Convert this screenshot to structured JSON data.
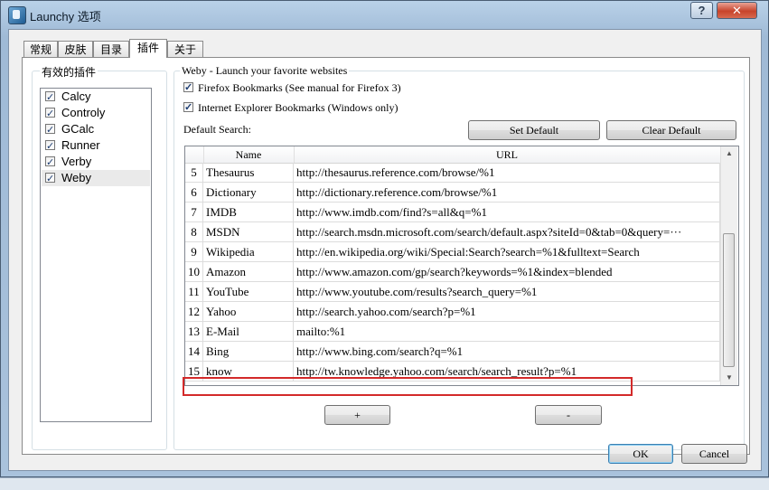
{
  "window": {
    "title": "Launchy 选项"
  },
  "tabs": [
    "常规",
    "皮肤",
    "目录",
    "插件",
    "关于"
  ],
  "plugins_group": {
    "label": "有效的插件",
    "items": [
      {
        "label": "Calcy",
        "checked": true
      },
      {
        "label": "Controly",
        "checked": true
      },
      {
        "label": "GCalc",
        "checked": true
      },
      {
        "label": "Runner",
        "checked": true
      },
      {
        "label": "Verby",
        "checked": true
      },
      {
        "label": "Weby",
        "checked": true
      }
    ]
  },
  "weby": {
    "group_label": "Weby - Launch your favorite websites",
    "firefox_label": "Firefox Bookmarks (See manual for Firefox 3)",
    "ie_label": "Internet Explorer Bookmarks (Windows only)",
    "default_search_label": "Default Search:",
    "set_default": "Set Default",
    "clear_default": "Clear Default",
    "columns": [
      "Name",
      "URL"
    ],
    "rows": [
      {
        "num": "5",
        "name": "Thesaurus",
        "url": "http://thesaurus.reference.com/browse/%1"
      },
      {
        "num": "6",
        "name": "Dictionary",
        "url": "http://dictionary.reference.com/browse/%1"
      },
      {
        "num": "7",
        "name": "IMDB",
        "url": "http://www.imdb.com/find?s=all&q=%1"
      },
      {
        "num": "8",
        "name": "MSDN",
        "url": "http://search.msdn.microsoft.com/search/default.aspx?siteId=0&tab=0&query=···"
      },
      {
        "num": "9",
        "name": "Wikipedia",
        "url": "http://en.wikipedia.org/wiki/Special:Search?search=%1&fulltext=Search"
      },
      {
        "num": "10",
        "name": "Amazon",
        "url": "http://www.amazon.com/gp/search?keywords=%1&index=blended"
      },
      {
        "num": "11",
        "name": "YouTube",
        "url": "http://www.youtube.com/results?search_query=%1"
      },
      {
        "num": "12",
        "name": "Yahoo",
        "url": "http://search.yahoo.com/search?p=%1"
      },
      {
        "num": "13",
        "name": "E-Mail",
        "url": "mailto:%1"
      },
      {
        "num": "14",
        "name": "Bing",
        "url": "http://www.bing.com/search?q=%1"
      },
      {
        "num": "15",
        "name": "know",
        "url": "http://tw.knowledge.yahoo.com/search/search_result?p=%1"
      }
    ],
    "add_label": "+",
    "remove_label": "-"
  },
  "footer": {
    "ok": "OK",
    "cancel": "Cancel"
  },
  "title_controls": {
    "help": "?",
    "close": "✕"
  },
  "colors": {
    "highlight_border": "#d32a2a",
    "title_gradient_top": "#b9d1e8"
  }
}
